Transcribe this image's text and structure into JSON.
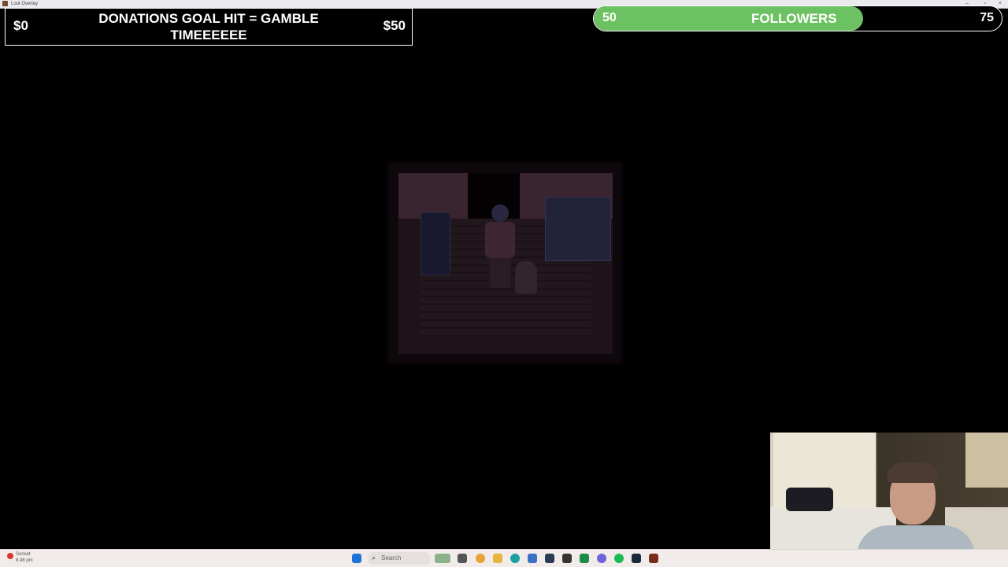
{
  "window": {
    "title": "Loot Overlay"
  },
  "donation_goal": {
    "min_label": "$0",
    "max_label": "$50",
    "title": "DONATIONS GOAL HIT = GAMBLE TIMEEEEEE",
    "progress": 0
  },
  "followers_goal": {
    "start_label": "50",
    "label": "FOLLOWERS",
    "end_label": "75",
    "progress_fraction": 0.66,
    "fill_color": "#6cc262"
  },
  "taskbar": {
    "weather_label": "Sunset",
    "weather_time": "8:46 pm",
    "search_placeholder": "Search",
    "icons": [
      "start-icon",
      "search-icon",
      "widgets-icon",
      "file-explorer-icon",
      "chrome-icon",
      "folder-icon",
      "edge-icon",
      "store-icon",
      "steam-icon",
      "epic-games-icon",
      "terminal-icon",
      "discord-icon",
      "spotify-icon",
      "steam-icon",
      "game-icon"
    ]
  },
  "colors": {
    "background": "#000000",
    "accent_green": "#6cc262",
    "taskbar": "#f1ece9"
  }
}
